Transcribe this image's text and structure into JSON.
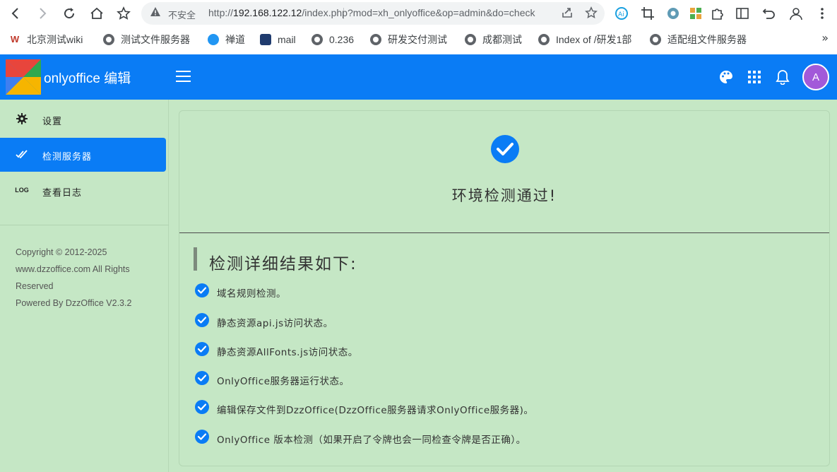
{
  "browser": {
    "omnibox": {
      "warning_label": "不安全",
      "url_prefix": "http://",
      "url_host": "192.168.122.12",
      "url_path": "/index.php?mod=xh_onlyoffice&op=admin&do=check"
    },
    "bookmarks": [
      {
        "label": "北京测试wiki",
        "icon": "w-icon"
      },
      {
        "label": "测试文件服务器",
        "icon": "globe-icon"
      },
      {
        "label": "禅道",
        "icon": "chandao-icon"
      },
      {
        "label": "mail",
        "icon": "mail-icon"
      },
      {
        "label": "0.236",
        "icon": "globe-icon"
      },
      {
        "label": "研发交付测试",
        "icon": "globe-icon"
      },
      {
        "label": "成都测试",
        "icon": "globe-icon"
      },
      {
        "label": "Index of /研发1部",
        "icon": "globe-icon"
      },
      {
        "label": "适配组文件服务器",
        "icon": "globe-icon"
      }
    ]
  },
  "header": {
    "app_title": "onlyoffice 编辑",
    "avatar_initial": "A",
    "accent_color": "#0a7cf5"
  },
  "sidebar": {
    "items": [
      {
        "label": "设置",
        "icon": "gear-icon",
        "active": false
      },
      {
        "label": "检测服务器",
        "icon": "double-check-icon",
        "active": true
      },
      {
        "label": "查看日志",
        "icon": "log-icon",
        "active": false
      }
    ],
    "log_icon_text": "LOG",
    "copyright_lines": [
      "Copyright © 2012-2025",
      "www.dzzoffice.com All Rights",
      "Reserved",
      "Powered By DzzOffice V2.3.2"
    ]
  },
  "main": {
    "pass_title": "环境检测通过!",
    "detail_title": "检测详细结果如下:",
    "results": [
      "域名规则检测。",
      "静态资源api.js访问状态。",
      "静态资源AllFonts.js访问状态。",
      "OnlyOffice服务器运行状态。",
      "编辑保存文件到DzzOffice(DzzOffice服务器请求OnlyOffice服务器)。",
      "OnlyOffice 版本检测（如果开启了令牌也会一同检查令牌是否正确）。"
    ]
  }
}
